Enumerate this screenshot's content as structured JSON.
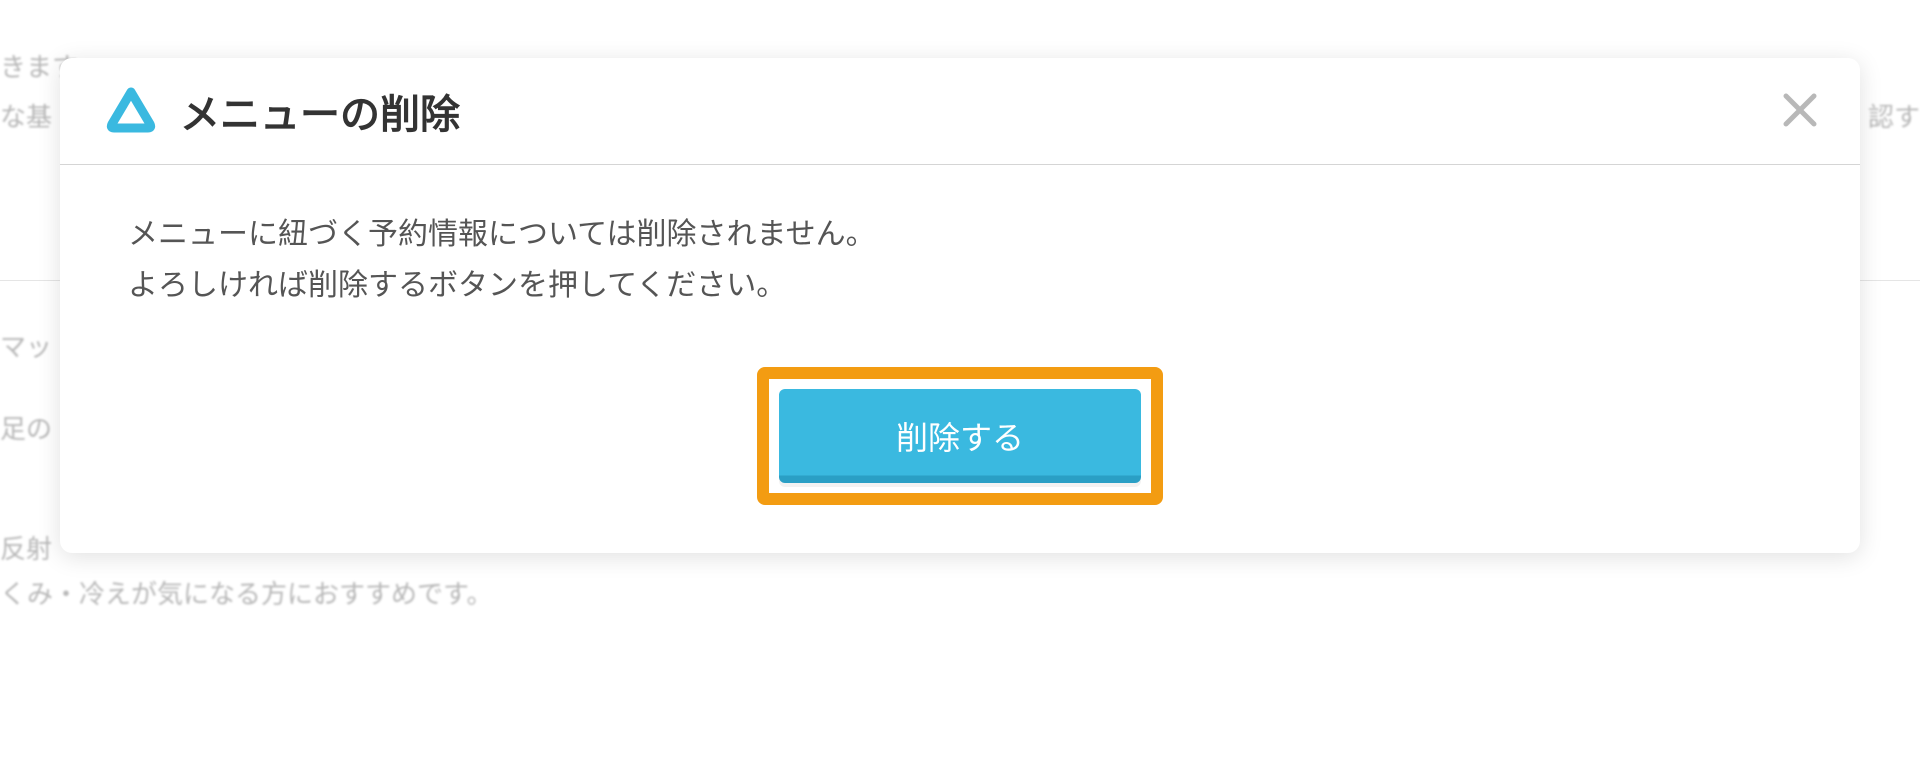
{
  "background": {
    "text1": "きます",
    "text2": "な基",
    "text3": "マッ",
    "text4": "足の",
    "text5": "反射",
    "text6": "くみ・冷えが気になる方におすすめです。",
    "text7": "認す"
  },
  "modal": {
    "title": "メニューの削除",
    "message_line1": "メニューに紐づく予約情報については削除されません。",
    "message_line2": "よろしければ削除するボタンを押してください。",
    "delete_button_label": "削除する"
  },
  "colors": {
    "accent": "#3ab9e0",
    "highlight": "#f39c12",
    "text_primary": "#333333",
    "text_secondary": "#555555"
  }
}
